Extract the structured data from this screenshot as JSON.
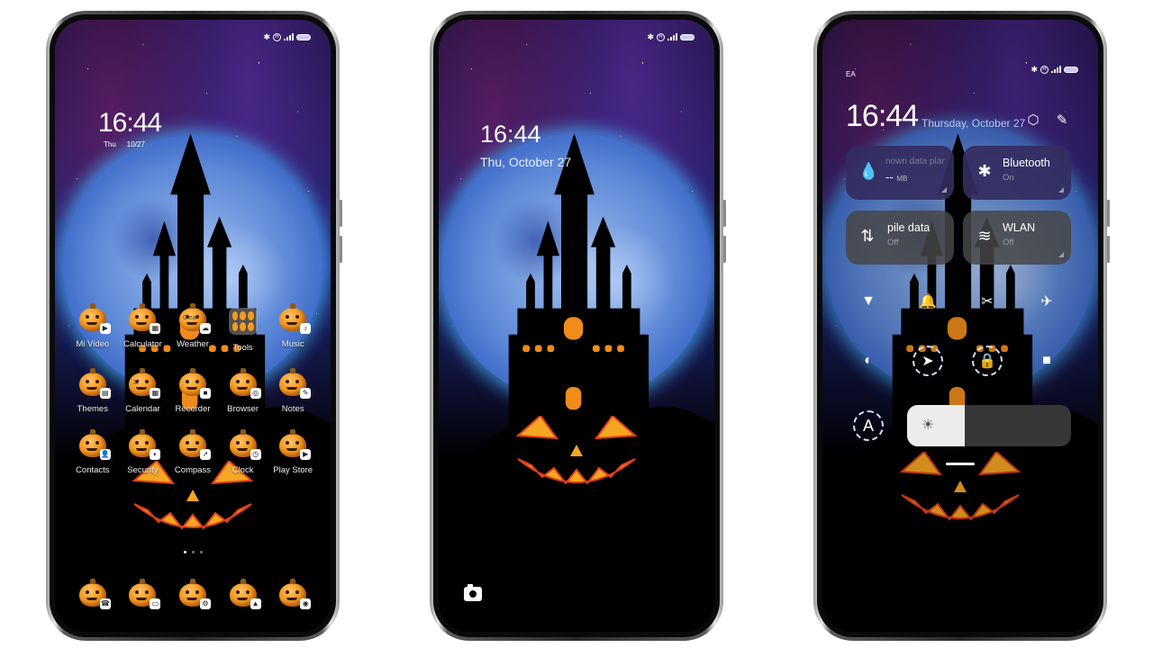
{
  "status_bar": {
    "icons": [
      "bluetooth-icon",
      "registered-icon",
      "signal-icon",
      "battery-icon"
    ],
    "network_badge": "E",
    "registered_glyph": "R"
  },
  "home_screen": {
    "clock": {
      "time": "16:44",
      "day": "Thu",
      "date": "10/27"
    },
    "apps": [
      {
        "label": "Mi Video",
        "badge": "▶",
        "icon": "video-icon"
      },
      {
        "label": "Calculator",
        "badge": "▦",
        "icon": "calculator-icon"
      },
      {
        "label": "Weather",
        "badge": "☁",
        "icon": "weather-icon",
        "overlay": "Clear"
      },
      {
        "label": "Tools",
        "icon": "folder-icon"
      },
      {
        "label": "Music",
        "badge": "♪",
        "icon": "music-icon"
      },
      {
        "label": "Themes",
        "badge": "▤",
        "icon": "themes-icon"
      },
      {
        "label": "Calendar",
        "badge": "▦",
        "icon": "calendar-icon",
        "overlay": "27"
      },
      {
        "label": "Recorder",
        "badge": "■",
        "icon": "recorder-icon"
      },
      {
        "label": "Browser",
        "badge": "◎",
        "icon": "browser-icon"
      },
      {
        "label": "Notes",
        "badge": "✎",
        "icon": "notes-icon"
      },
      {
        "label": "Contacts",
        "badge": "👤",
        "icon": "contacts-icon"
      },
      {
        "label": "Security",
        "badge": "◐",
        "icon": "security-icon"
      },
      {
        "label": "Compass",
        "badge": "➚",
        "icon": "compass-icon"
      },
      {
        "label": "Clock",
        "badge": "◷",
        "icon": "clock-icon"
      },
      {
        "label": "Play Store",
        "badge": "▶",
        "icon": "play-store-icon"
      }
    ],
    "page_indicator": {
      "pages": 3,
      "current": 1
    },
    "dock": [
      {
        "name": "phone",
        "badge": "☎",
        "icon": "phone-icon"
      },
      {
        "name": "messages",
        "badge": "▭",
        "icon": "messages-icon"
      },
      {
        "name": "settings",
        "badge": "⚙",
        "icon": "settings-icon"
      },
      {
        "name": "gallery",
        "badge": "▲",
        "icon": "gallery-icon"
      },
      {
        "name": "camera",
        "badge": "◉",
        "icon": "camera-icon"
      }
    ]
  },
  "lock_screen": {
    "time": "16:44",
    "date": "Thu, October  27",
    "camera_shortcut": "camera-icon"
  },
  "control_center": {
    "carrier": "EA",
    "time": "16:44",
    "date": "Thursday, October 27",
    "tiles": [
      {
        "title": "nown data plan",
        "sub_value": "--",
        "sub_unit": "MB",
        "icon": "water-drop-icon",
        "state": "on"
      },
      {
        "title": "Bluetooth",
        "sub": "On",
        "icon": "bluetooth-icon",
        "state": "on"
      },
      {
        "title": "pile data",
        "sub": "Off",
        "icon": "mobile-data-icon",
        "state": "off"
      },
      {
        "title": "WLAN",
        "sub": "Off",
        "icon": "wifi-icon",
        "state": "off"
      }
    ],
    "toggles": [
      {
        "name": "flashlight",
        "glyph": "🔦"
      },
      {
        "name": "silent",
        "glyph": "🔔"
      },
      {
        "name": "screenshot",
        "glyph": "✂"
      },
      {
        "name": "airplane",
        "glyph": "✈"
      },
      {
        "name": "dark-mode",
        "glyph": "◐"
      },
      {
        "name": "location",
        "glyph": "➤"
      },
      {
        "name": "rotation-lock",
        "glyph": "🔒"
      },
      {
        "name": "screen-record",
        "glyph": "■"
      },
      {
        "name": "auto-brightness",
        "glyph": "A"
      }
    ],
    "brightness_percent": 35,
    "brightness_icon": "☀"
  },
  "colors": {
    "pumpkin_orange": "#f59a22",
    "tile_active": "#342d5f",
    "tile_inactive": "#464646",
    "date_tint": "#b8c4ff"
  }
}
